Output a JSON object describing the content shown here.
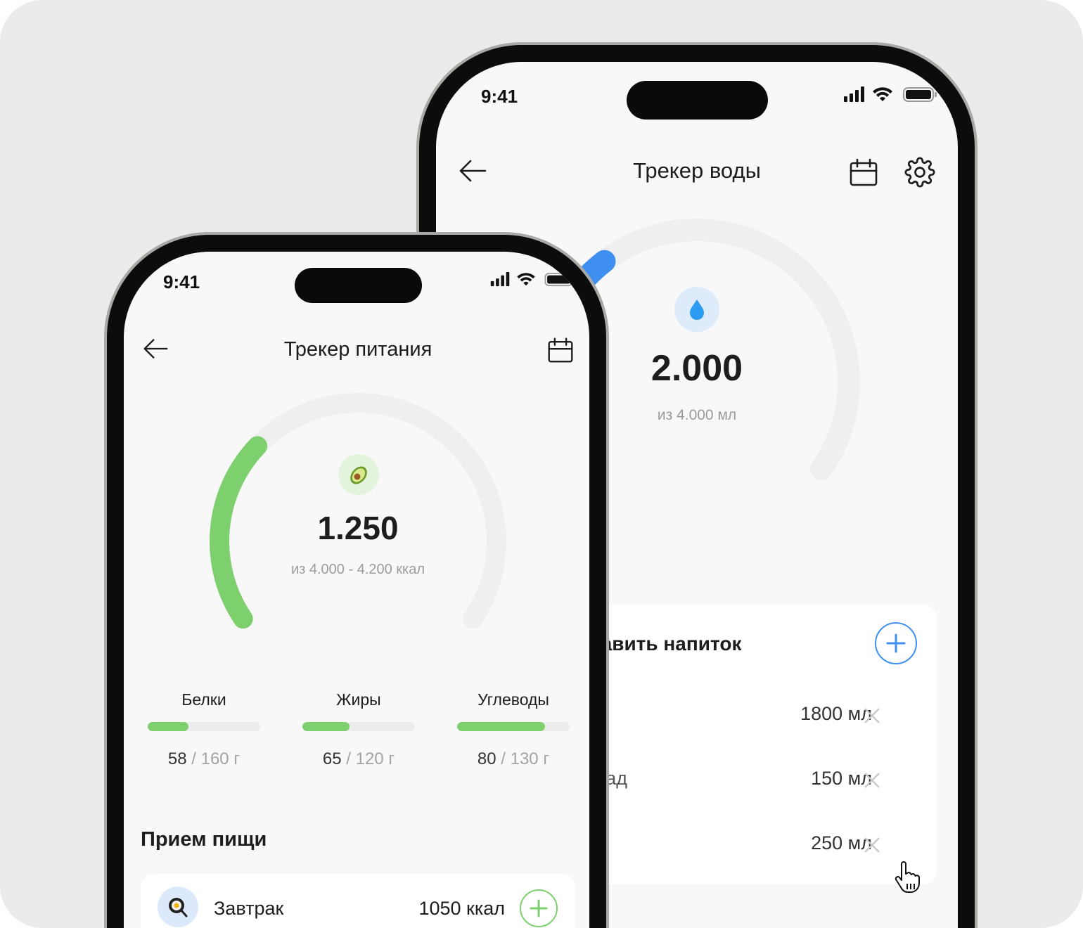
{
  "water_app": {
    "status_time": "9:41",
    "title": "Трекер воды",
    "gauge": {
      "value": "2.000",
      "subtitle": "из 4.000 мл",
      "fill": 0.35,
      "color": "#3f8ff0"
    },
    "add_drink_title": "Добавить напиток",
    "drinks": [
      {
        "name": "",
        "amount": "1800 мл"
      },
      {
        "name": "Лимонад",
        "amount": "150 мл"
      },
      {
        "name": "",
        "amount": "250 мл"
      }
    ]
  },
  "nutrition_app": {
    "status_time": "9:41",
    "title": "Трекер питания",
    "gauge": {
      "value": "1.250",
      "subtitle": "из 4.000 - 4.200 ккал",
      "fill": 0.3125,
      "color": "#7ed06e"
    },
    "macros": [
      {
        "label": "Белки",
        "current": "58",
        "total": " / 160 г",
        "fraction": 0.3625
      },
      {
        "label": "Жиры",
        "current": "65",
        "total": " / 120 г",
        "fraction": 0.4167
      },
      {
        "label": "Углеводы",
        "current": "80",
        "total": " / 130 г",
        "fraction": 0.78
      }
    ],
    "meals_title": "Прием пищи",
    "meals": [
      {
        "name": "Завтрак",
        "calories": "1050 ккал"
      }
    ]
  }
}
